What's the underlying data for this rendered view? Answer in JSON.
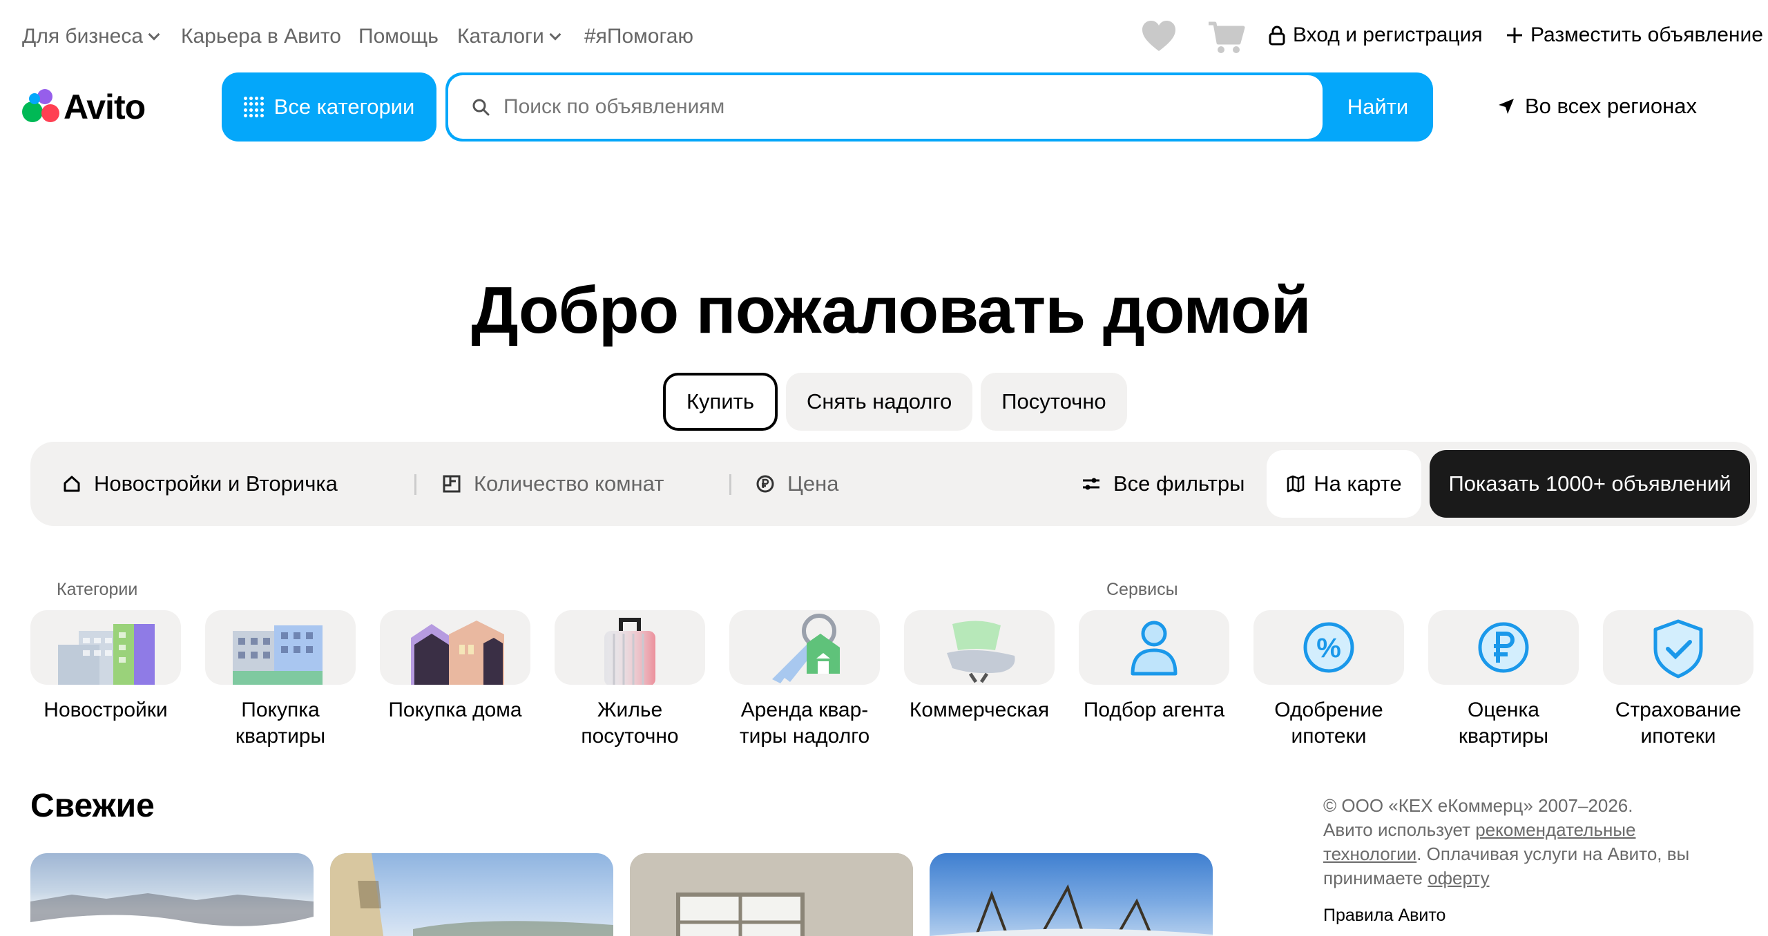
{
  "top_nav": {
    "business": "Для бизнеса",
    "career": "Карьера в Авито",
    "help": "Помощь",
    "catalogs": "Каталоги",
    "helping": "#яПомогаю",
    "login": "Вход и регистрация",
    "post_ad": "Разместить объявление"
  },
  "header": {
    "logo": "Avito",
    "categories_button": "Все категории",
    "search_placeholder": "Поиск по объявлениям",
    "search_button": "Найти",
    "region": "Во всех регионах"
  },
  "hero": {
    "title": "Добро пожаловать домой",
    "tabs": [
      "Купить",
      "Снять надолго",
      "Посуточно"
    ],
    "active_tab": "Купить"
  },
  "filters": {
    "property_type": "Новостройки и Вторичка",
    "rooms": "Количество комнат",
    "price": "Цена",
    "all_filters": "Все фильтры",
    "map": "На карте",
    "show": "Показать 1000+ объявлений"
  },
  "categories": {
    "label": "Категории",
    "items": [
      {
        "line1": "Новостройки",
        "line2": ""
      },
      {
        "line1": "Покупка",
        "line2": "квартиры"
      },
      {
        "line1": "Покупка дома",
        "line2": ""
      },
      {
        "line1": "Жилье",
        "line2": "посуточно"
      },
      {
        "line1": "Аренда квар-",
        "line2": "тиры надолго"
      },
      {
        "line1": "Коммерческая",
        "line2": ""
      }
    ]
  },
  "services": {
    "label": "Сервисы",
    "items": [
      {
        "line1": "Подбор агента",
        "line2": ""
      },
      {
        "line1": "Одобрение",
        "line2": "ипотеки"
      },
      {
        "line1": "Оценка",
        "line2": "квартиры"
      },
      {
        "line1": "Страхование",
        "line2": "ипотеки"
      }
    ]
  },
  "fresh": {
    "title": "Свежие"
  },
  "footer": {
    "copyright": "© ООО «КЕХ еКоммерц» 2007–2026.",
    "uses": "Авито использует",
    "rec_tech": "рекомендательные технологии",
    "paying": ". Оплачивая услуги на Авито, вы принимаете",
    "offer": "оферту",
    "rules": "Правила Авито"
  },
  "colors": {
    "accent": "#04a7fa",
    "dark_button": "#1a1a1a",
    "surface": "#f2f1f0"
  }
}
